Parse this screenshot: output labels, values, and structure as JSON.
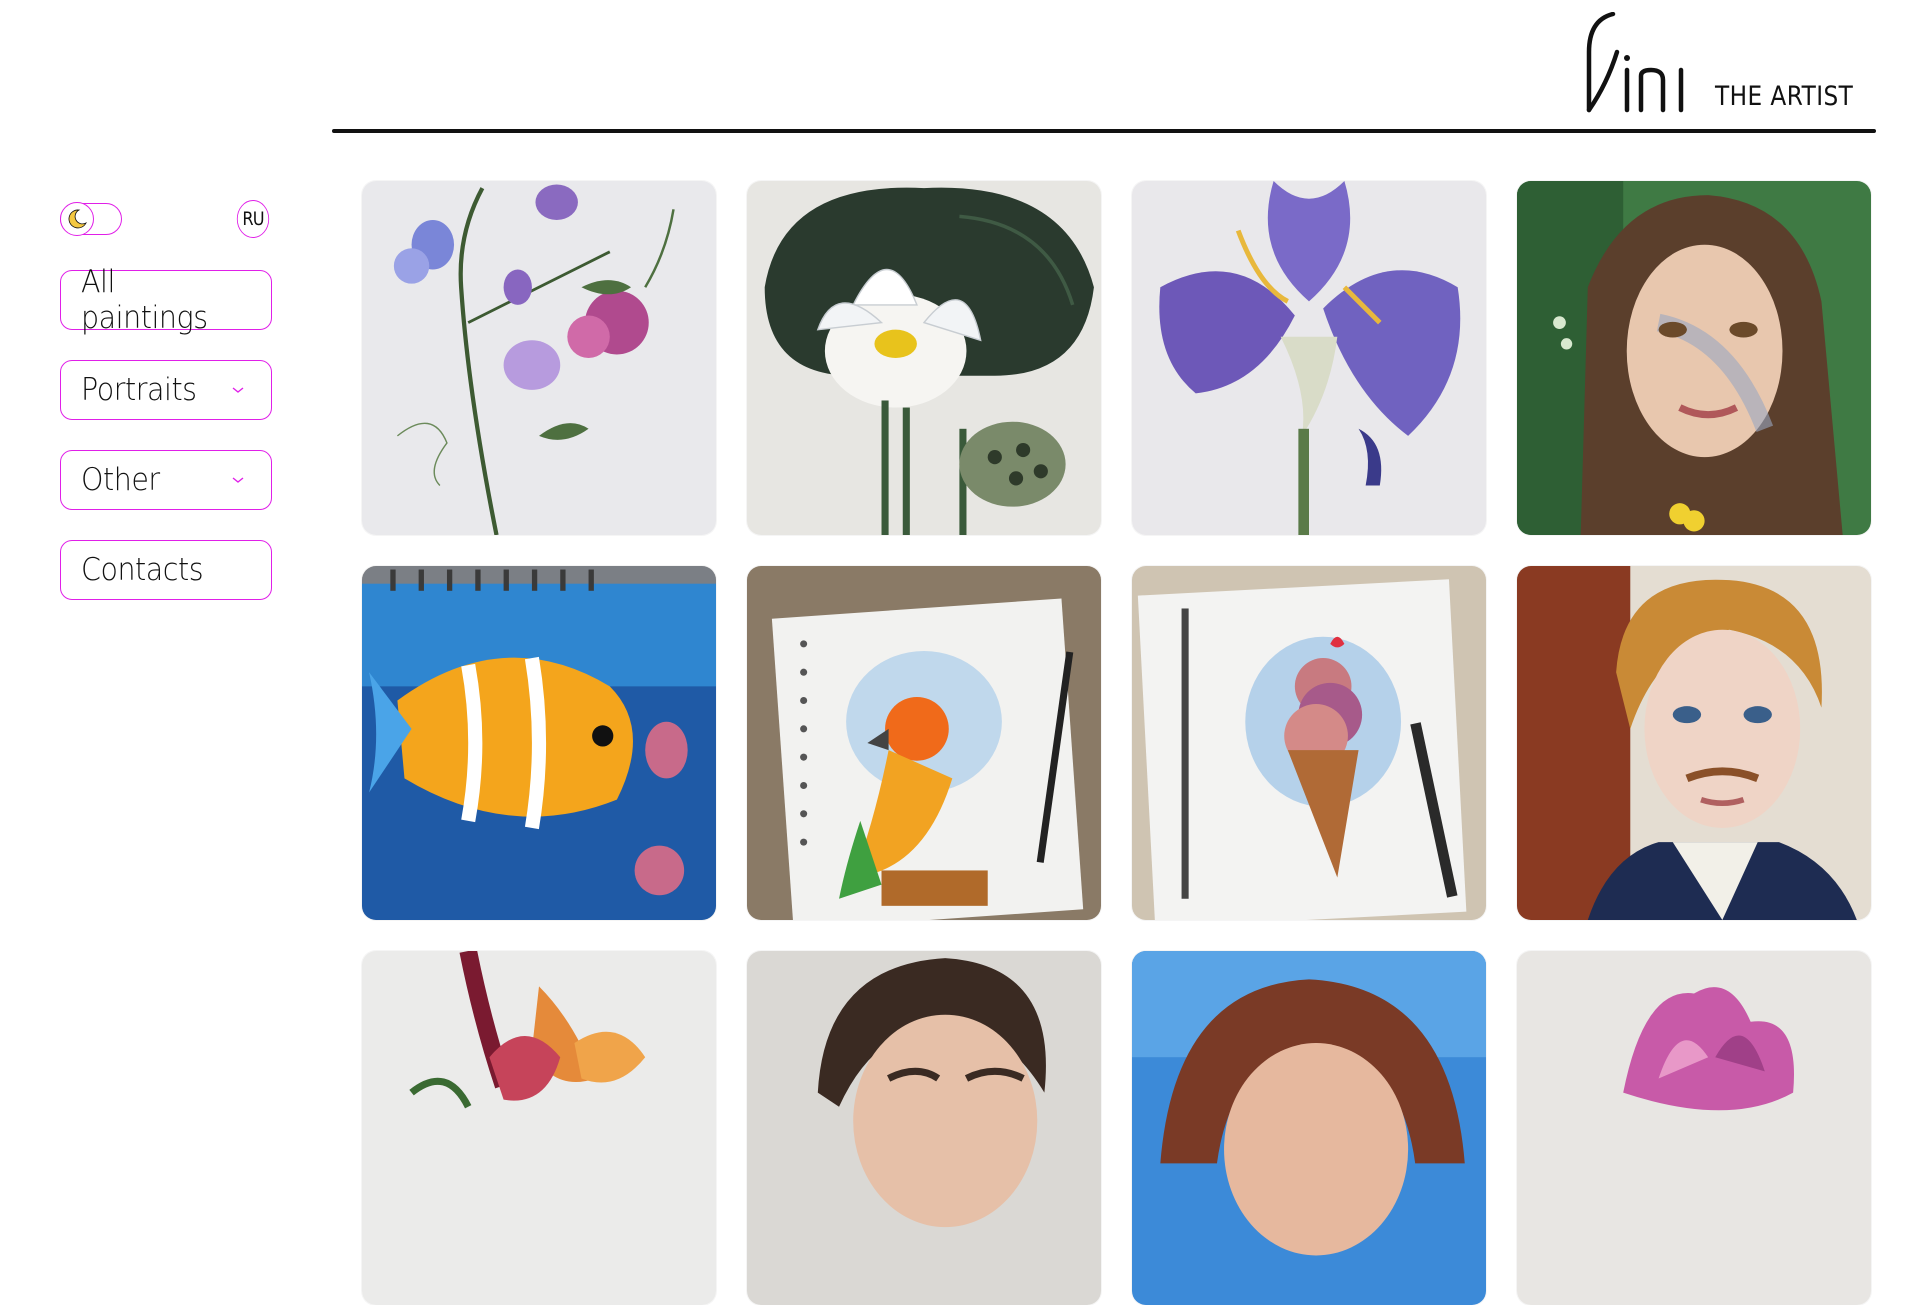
{
  "brand": {
    "logo_mark": "Vini",
    "tagline": "THE ARTIST"
  },
  "sidebar": {
    "theme_toggle": {
      "icon": "moon-icon",
      "state": "light"
    },
    "language_label": "RU",
    "nav": [
      {
        "label": "All paintings",
        "has_dropdown": false
      },
      {
        "label": "Portraits",
        "has_dropdown": true
      },
      {
        "label": "Other",
        "has_dropdown": true
      },
      {
        "label": "Contacts",
        "has_dropdown": false
      }
    ]
  },
  "gallery": {
    "items": [
      {
        "subject": "sweet-pea-flowers"
      },
      {
        "subject": "white-lotus"
      },
      {
        "subject": "purple-iris"
      },
      {
        "subject": "girl-portrait"
      },
      {
        "subject": "tropical-fish-sketchbook"
      },
      {
        "subject": "parrot-sketchbook"
      },
      {
        "subject": "ice-cream-sketchbook"
      },
      {
        "subject": "man-with-mustache-portrait"
      },
      {
        "subject": "orchid-flowers"
      },
      {
        "subject": "man-portrait"
      },
      {
        "subject": "woman-portrait"
      },
      {
        "subject": "pink-magnolia"
      }
    ]
  },
  "colors": {
    "accent": "#e01fe8",
    "text": "#111111",
    "rule": "#111111",
    "moon": "#f4c842"
  }
}
